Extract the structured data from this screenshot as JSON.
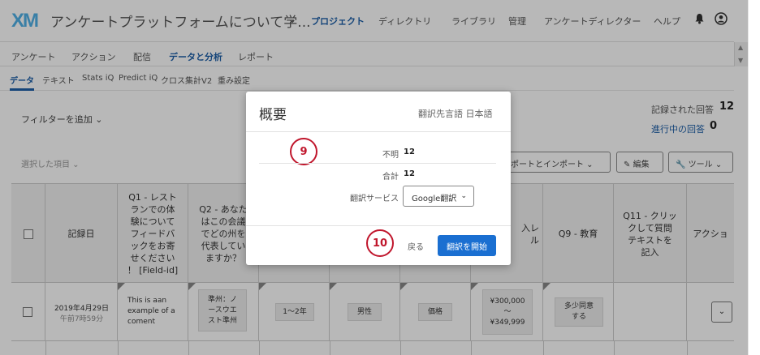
{
  "topbar": {
    "logo": "XM",
    "project_title": "アンケートプラットフォームについて学...",
    "nav": [
      "プロジェクト",
      "ディレクトリ",
      "ライブラリ",
      "管理",
      "アンケートディレクター",
      "ヘルプ"
    ]
  },
  "subnav": [
    "アンケート",
    "アクション",
    "配信",
    "データと分析",
    "レポート"
  ],
  "tabs": [
    "データ",
    "テキスト",
    "Stats iQ",
    "Predict iQ",
    "クロス集計V2",
    "重み設定"
  ],
  "filter": {
    "label": "フィルターを追加"
  },
  "stats": {
    "recorded_label": "記録された回答",
    "recorded_value": "12",
    "in_progress_label": "進行中の回答",
    "in_progress_value": "0"
  },
  "toolbar": {
    "selected_items": "選択した項目",
    "export_import": "スポートとインポート",
    "edit": "編集",
    "tools": "ツール"
  },
  "table": {
    "headers": {
      "record_date": "記録日",
      "q1_prefix": "Q1 - レスト",
      "q1_lines": [
        "ランでの体",
        "験について",
        "フィードバ",
        "ックをお寄",
        "せください",
        "！ [Field-id]"
      ],
      "q2_lines": [
        "Q2 - あなた",
        "はこの会議",
        "でどの州を",
        "代表してい",
        "ますか？"
      ],
      "income_lines": [
        "入レ",
        "ル"
      ],
      "q9": "Q9 - 教育",
      "q11_lines": [
        "Q11 - クリッ",
        "クして質問",
        "テキストを",
        "記入"
      ],
      "action": "アクショ"
    },
    "row": {
      "date": "2019年4月29日",
      "time": "午前7時59分",
      "comment_lines": [
        "This is aan",
        "example of a",
        "coment"
      ],
      "state_lines": [
        "準州：ノ",
        "ースウエ",
        "スト準州"
      ],
      "years": "1～2年",
      "gender": "男性",
      "price": "価格",
      "income_lines": [
        "¥300,000",
        "～",
        "¥349,999"
      ],
      "education_lines": [
        "多少同意",
        "する"
      ]
    }
  },
  "modal": {
    "title": "概要",
    "language": "翻訳先言語 日本語",
    "marker_a": "9",
    "unknown_label": "不明",
    "unknown_value": "12",
    "total_label": "合計",
    "total_value": "12",
    "service_label": "翻訳サービス",
    "service_value": "Google翻訳",
    "marker_b": "10",
    "back": "戻る",
    "start": "翻訳を開始"
  }
}
